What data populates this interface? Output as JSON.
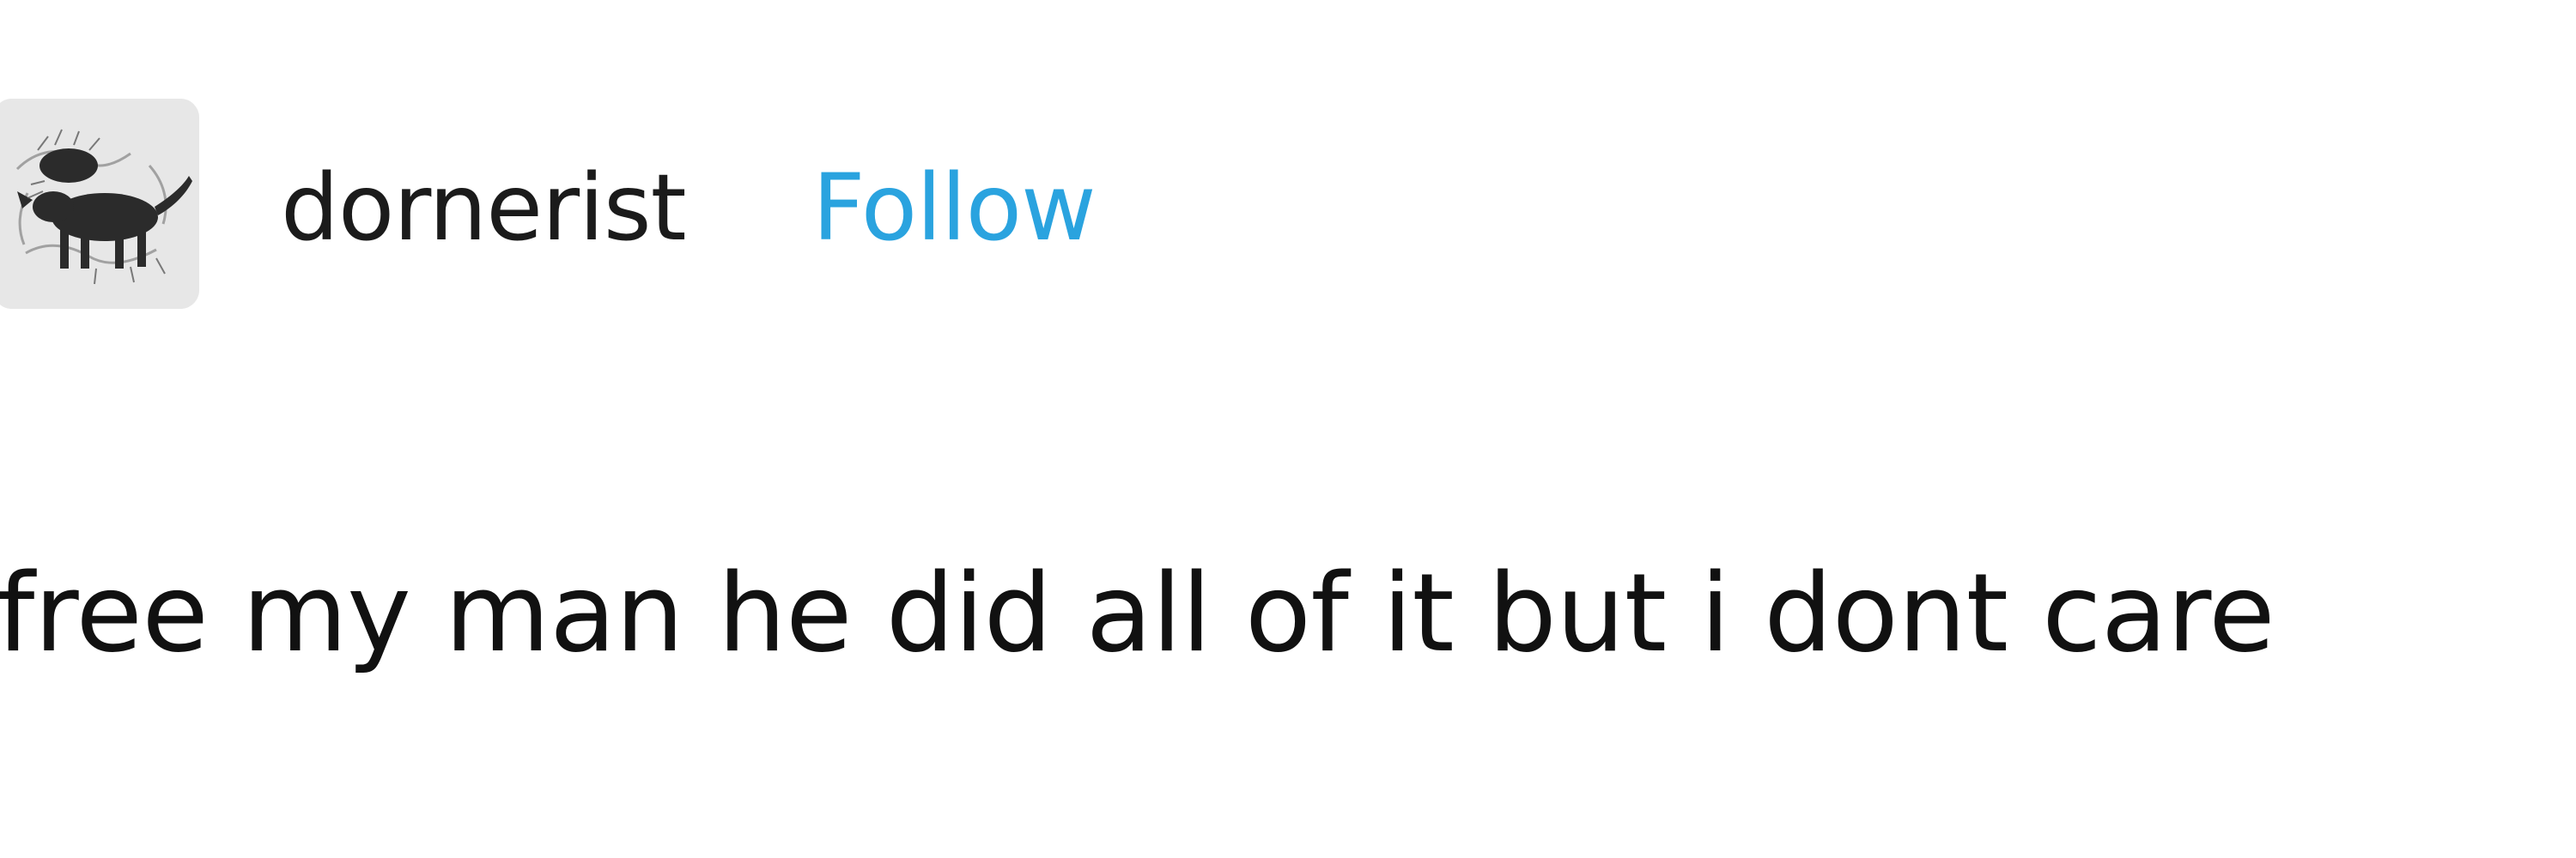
{
  "post": {
    "author": {
      "username": "dornerist",
      "follow_label": "Follow",
      "avatar_icon": "dog-sketch-avatar"
    },
    "body_text": "free my man he did all of it but i dont care"
  },
  "colors": {
    "background": "#ffffff",
    "text": "#1b1b1b",
    "follow_link": "#2aa3df",
    "avatar_background": "#e9e9e9"
  }
}
